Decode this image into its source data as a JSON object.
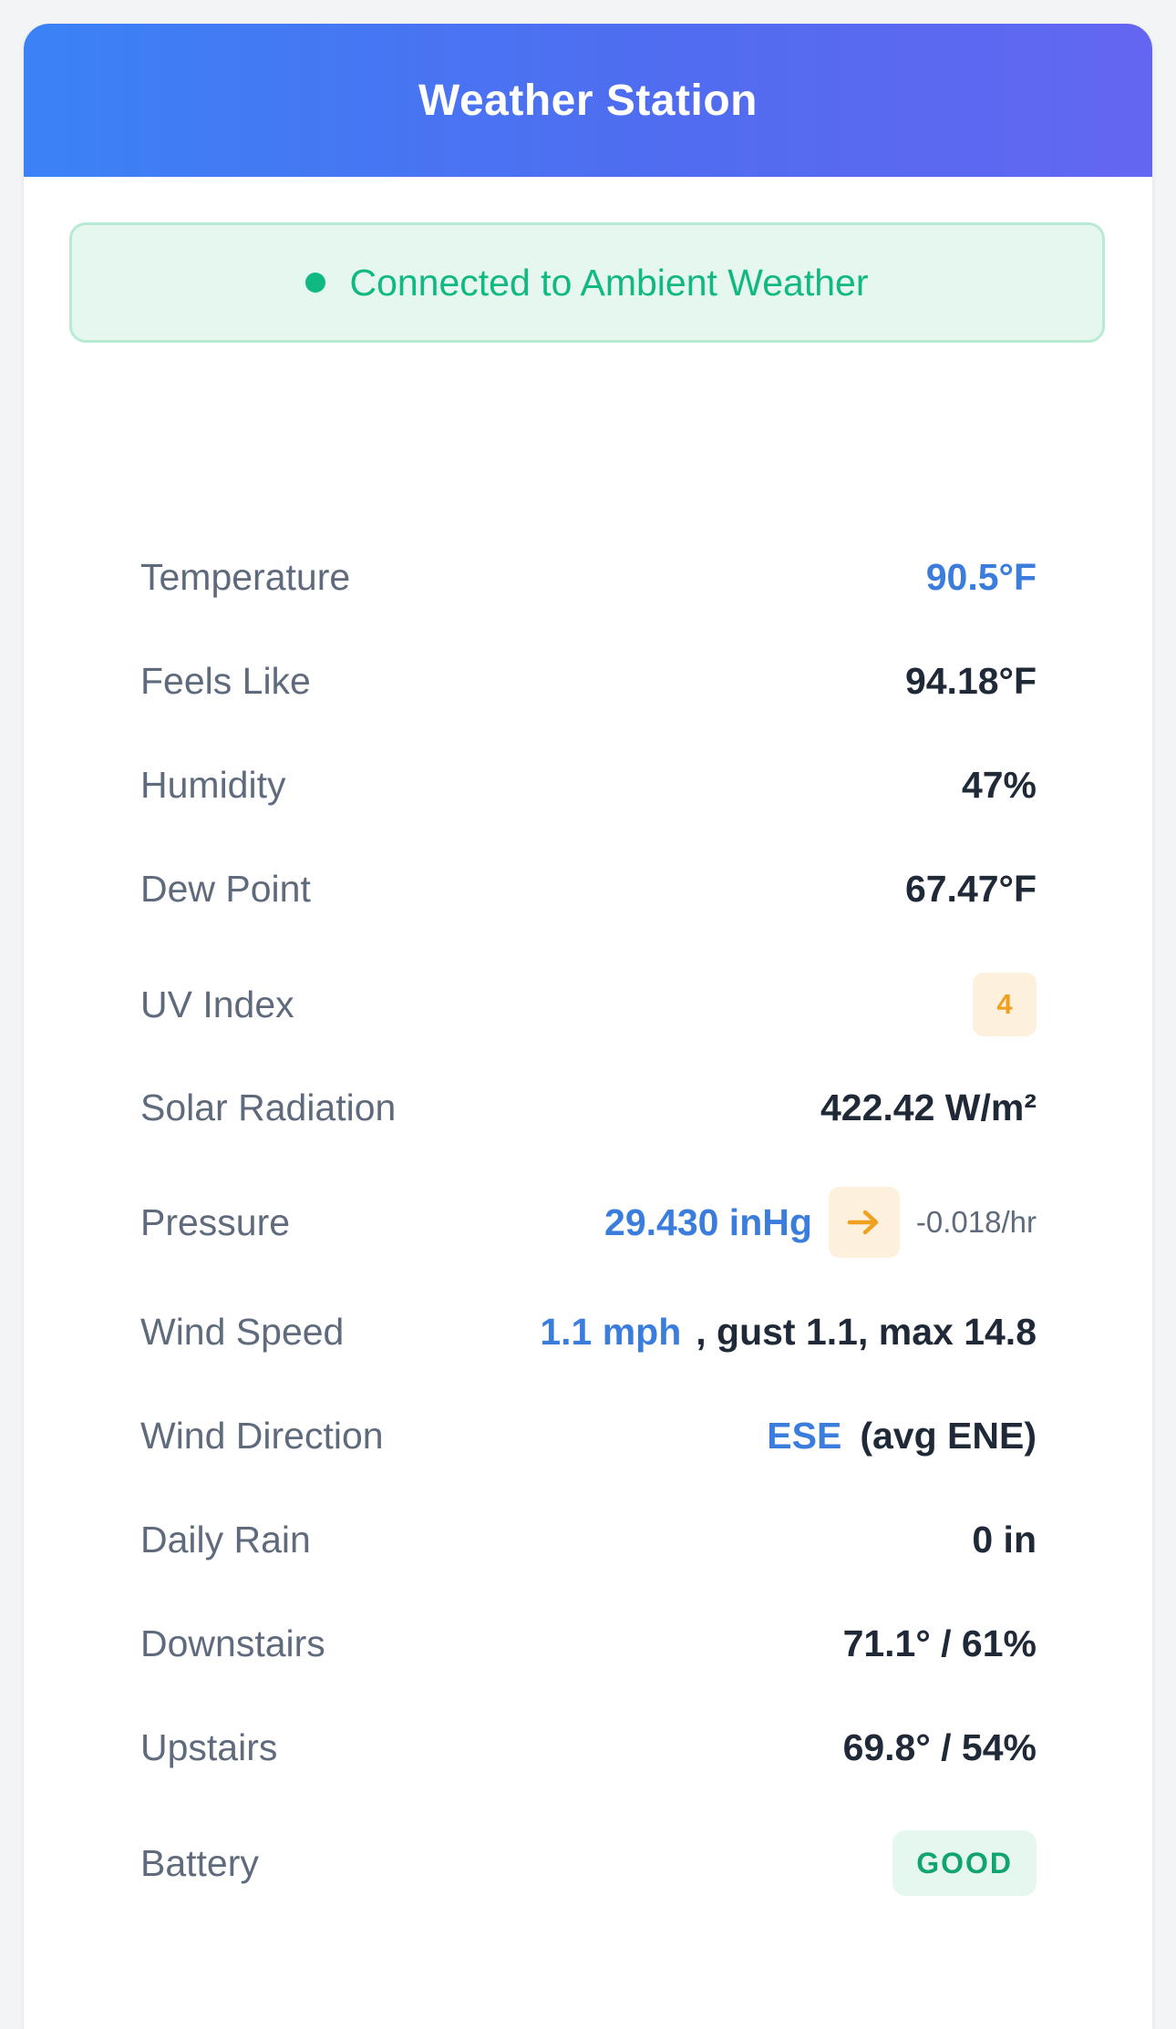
{
  "header": {
    "title": "Weather Station"
  },
  "status": {
    "text": "Connected to Ambient Weather",
    "color": "#10b981"
  },
  "readings": {
    "temperature": {
      "label": "Temperature",
      "value": "90.5°F"
    },
    "feels_like": {
      "label": "Feels Like",
      "value": "94.18°F"
    },
    "humidity": {
      "label": "Humidity",
      "value": "47%"
    },
    "dew_point": {
      "label": "Dew Point",
      "value": "67.47°F"
    },
    "uv_index": {
      "label": "UV Index",
      "value": "4"
    },
    "solar_radiation": {
      "label": "Solar Radiation",
      "value": "422.42 W/m²"
    },
    "pressure": {
      "label": "Pressure",
      "value": "29.430 inHg",
      "trend_icon": "arrow-right-icon",
      "rate": "-0.018/hr"
    },
    "wind_speed": {
      "label": "Wind Speed",
      "value": "1.1 mph",
      "detail": ", gust 1.1, max 14.8"
    },
    "wind_direction": {
      "label": "Wind Direction",
      "value": "ESE",
      "detail": "(avg ENE)"
    },
    "daily_rain": {
      "label": "Daily Rain",
      "value": "0 in"
    },
    "downstairs": {
      "label": "Downstairs",
      "value": "71.1° / 61%"
    },
    "upstairs": {
      "label": "Upstairs",
      "value": "69.8° / 54%"
    },
    "battery": {
      "label": "Battery",
      "value": "GOOD"
    }
  },
  "colors": {
    "accent_blue": "#3b7ddd",
    "warning_orange": "#f0a01e",
    "success_green": "#10b981"
  }
}
